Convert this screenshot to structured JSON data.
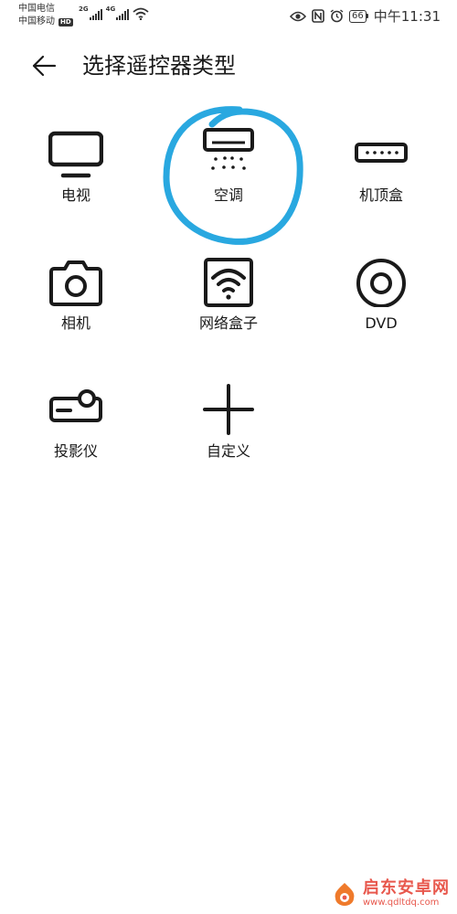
{
  "status_bar": {
    "carrier1": "中国电信",
    "carrier2": "中国移动",
    "hd": "HD",
    "sig1": "2G",
    "sig2": "4G",
    "battery": "66",
    "time": "中午11:31"
  },
  "header": {
    "title": "选择遥控器类型"
  },
  "devices": [
    {
      "label": "电视",
      "icon": "tv-icon"
    },
    {
      "label": "空调",
      "icon": "air-conditioner-icon"
    },
    {
      "label": "机顶盒",
      "icon": "set-top-box-icon"
    },
    {
      "label": "相机",
      "icon": "camera-icon"
    },
    {
      "label": "网络盒子",
      "icon": "network-box-icon"
    },
    {
      "label": "DVD",
      "icon": "dvd-icon"
    },
    {
      "label": "投影仪",
      "icon": "projector-icon"
    },
    {
      "label": "自定义",
      "icon": "plus-icon"
    }
  ],
  "annotation": {
    "color": "#29a8e0"
  },
  "watermark": {
    "name": "启东安卓网",
    "url": "www.qdltdq.com"
  }
}
